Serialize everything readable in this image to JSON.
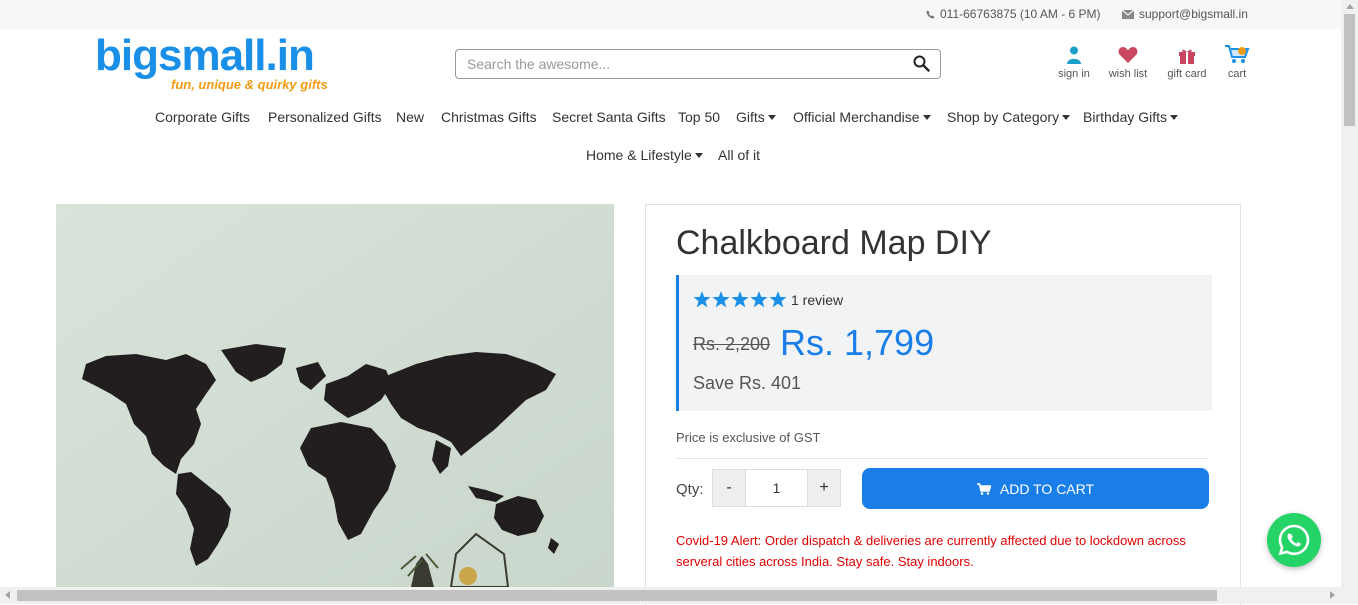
{
  "topbar": {
    "phone": "011-66763875 (10 AM - 6 PM)",
    "email": "support@bigsmall.in"
  },
  "logo": {
    "brand": "bigsmall.in",
    "tagline": "fun, unique & quirky gifts"
  },
  "search": {
    "placeholder": "Search the awesome..."
  },
  "user_links": {
    "signin": "sign in",
    "wishlist": "wish list",
    "giftcard": "gift card",
    "cart": "cart"
  },
  "nav": {
    "corporate": "Corporate Gifts",
    "personalized": "Personalized Gifts",
    "new": "New",
    "christmas": "Christmas Gifts",
    "secret_santa": "Secret Santa Gifts",
    "top50": "Top 50",
    "gifts": "Gifts",
    "merch": "Official Merchandise",
    "shop_by_category": "Shop by Category",
    "birthday": "Birthday Gifts",
    "home_lifestyle": "Home & Lifestyle",
    "all": "All of it"
  },
  "product": {
    "title": "Chalkboard Map DIY",
    "rating": 5,
    "reviews": "1 review",
    "old_price": "Rs. 2,200",
    "price": "Rs. 1,799",
    "save": "Save Rs. 401",
    "gst_note": "Price is exclusive of GST",
    "qty_label": "Qty:",
    "qty_minus": "-",
    "qty_value": "1",
    "qty_plus": "+",
    "add_to_cart": "ADD TO CART",
    "alert": "Covid-19 Alert: Order dispatch & deliveries are currently affected due to lockdown across serveral cities across India. Stay safe. Stay indoors."
  },
  "colors": {
    "brand_blue": "#1a8fe8",
    "price_blue": "#1a7ee8",
    "alert_red": "#e00000",
    "tagline_orange": "#f39c12",
    "whatsapp_green": "#25d366"
  },
  "icons": [
    "phone-icon",
    "mail-icon",
    "search-icon",
    "user-icon",
    "heart-icon",
    "gift-icon",
    "cart-icon",
    "star-icon",
    "whatsapp-icon"
  ]
}
